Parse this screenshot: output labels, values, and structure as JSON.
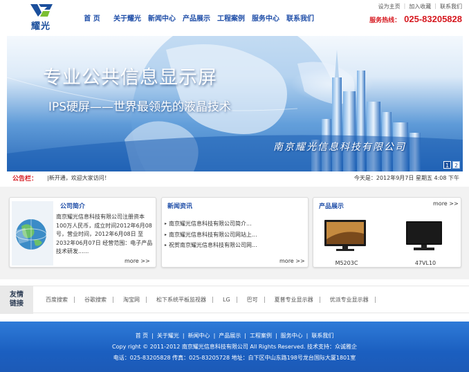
{
  "brand": {
    "name": "耀光"
  },
  "nav": [
    "首 页",
    "关于耀光",
    "新闻中心",
    "产品展示",
    "工程案例",
    "服务中心",
    "联系我们"
  ],
  "top_links": [
    "设为主页",
    "加入收藏",
    "联系我们"
  ],
  "hotline": {
    "label": "服务热线：",
    "number": "025-83205828"
  },
  "banner": {
    "title": "专业公共信息显示屏",
    "subtitle": "IPS硬屏——世界最领先的液晶技术",
    "company": "南京耀光信息科技有限公司",
    "pager": [
      "1",
      "2"
    ],
    "active_page": "1"
  },
  "notice": {
    "label": "公告栏：",
    "text": "|新开通，欢迎大家访问！",
    "date": "今天是：2012年9月7日 星期五 4:08 下午"
  },
  "about": {
    "title": "公司简介",
    "text": "南京耀光信息科技有限公司注册资本100万人民币，成立时间2012年6月08号，营业时间，2012年6月08日 至 2032年06月07日 经营范围：电子产品技术研发......",
    "more": "more >>"
  },
  "news": {
    "title": "新闻资讯",
    "items": [
      "南京耀光信息科技有限公司简介...",
      "南京耀光信息科技有限公司网站上...",
      "祝贺南京耀光信息科技有限公司网..."
    ],
    "more": "more >>"
  },
  "products": {
    "title": "产品展示",
    "more": "more >>",
    "items": [
      {
        "name": "M5203C"
      },
      {
        "name": "47VL10"
      }
    ]
  },
  "friends": {
    "label_line1": "友情",
    "label_line2": "链接",
    "links": [
      "百度搜索",
      "谷歌搜索",
      "淘宝网",
      "松下系统平板监视器",
      "LG",
      "巴可",
      "夏普专业显示器",
      "优派专业显示器"
    ]
  },
  "footer": {
    "nav": [
      "首 页",
      "关于耀光",
      "新闻中心",
      "产品展示",
      "工程案例",
      "服务中心",
      "联系我们"
    ],
    "copyright": "Copy right © 2011-2012 南京耀光信息科技有限公司 All Rights Reserved. 技术支持：众诚雅企",
    "contact": "电话：025-83205828 传真：025-83205728 地址：白下区中山东路198号龙台国际大厦1801室"
  },
  "colors": {
    "nav": "#1f4ea8",
    "accent_red": "#d6181f",
    "footer_bg": "#1b5fc0"
  }
}
